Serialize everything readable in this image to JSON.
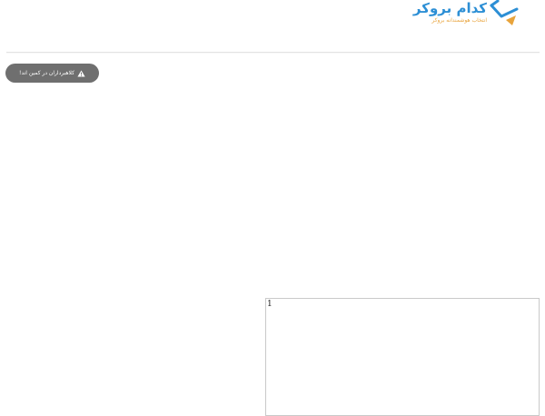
{
  "header": {
    "logo": {
      "title": "کدام بروکر",
      "subtitle": "انتخاب هوشمندانه بروکر",
      "icon": "paper-plane-logo-icon",
      "colors": {
        "primary": "#2d8fd5",
        "accent": "#e8a33b"
      }
    }
  },
  "alert_button": {
    "label": "کلاهبرداران در کمین اند!",
    "icon": "warning-triangle-icon",
    "background": "#6f6f6f"
  },
  "embed": {
    "content": "1"
  }
}
